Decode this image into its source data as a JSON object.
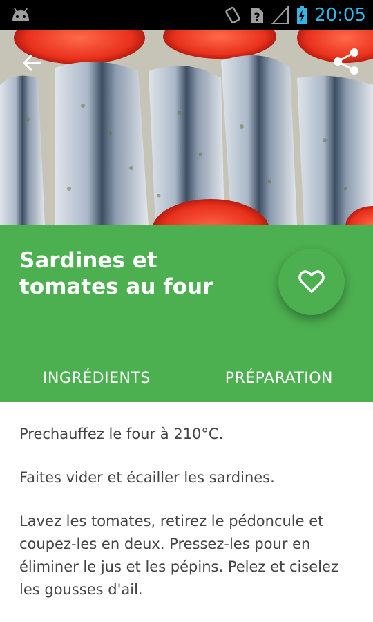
{
  "status_bar": {
    "time": "20:05"
  },
  "toolbar": {
    "back_icon": "arrow-back-icon",
    "share_icon": "share-icon"
  },
  "recipe": {
    "title": "Sardines et tomates au four",
    "favorite_icon": "heart-outline-icon"
  },
  "tabs": [
    {
      "label": "INGRÉDIENTS"
    },
    {
      "label": "PRÉPARATION"
    }
  ],
  "preparation": [
    "Prechauffez  le four à 210°C.",
    "Faites vider et écailler les sardines.",
    "Lavez les tomates, retirez le pédoncule et coupez-les en deux. Pressez-les pour en éliminer le jus et les pépins. Pelez et ciselez les gousses d'ail."
  ],
  "colors": {
    "primary": "#4caf50",
    "status_accent": "#33b5e5"
  }
}
